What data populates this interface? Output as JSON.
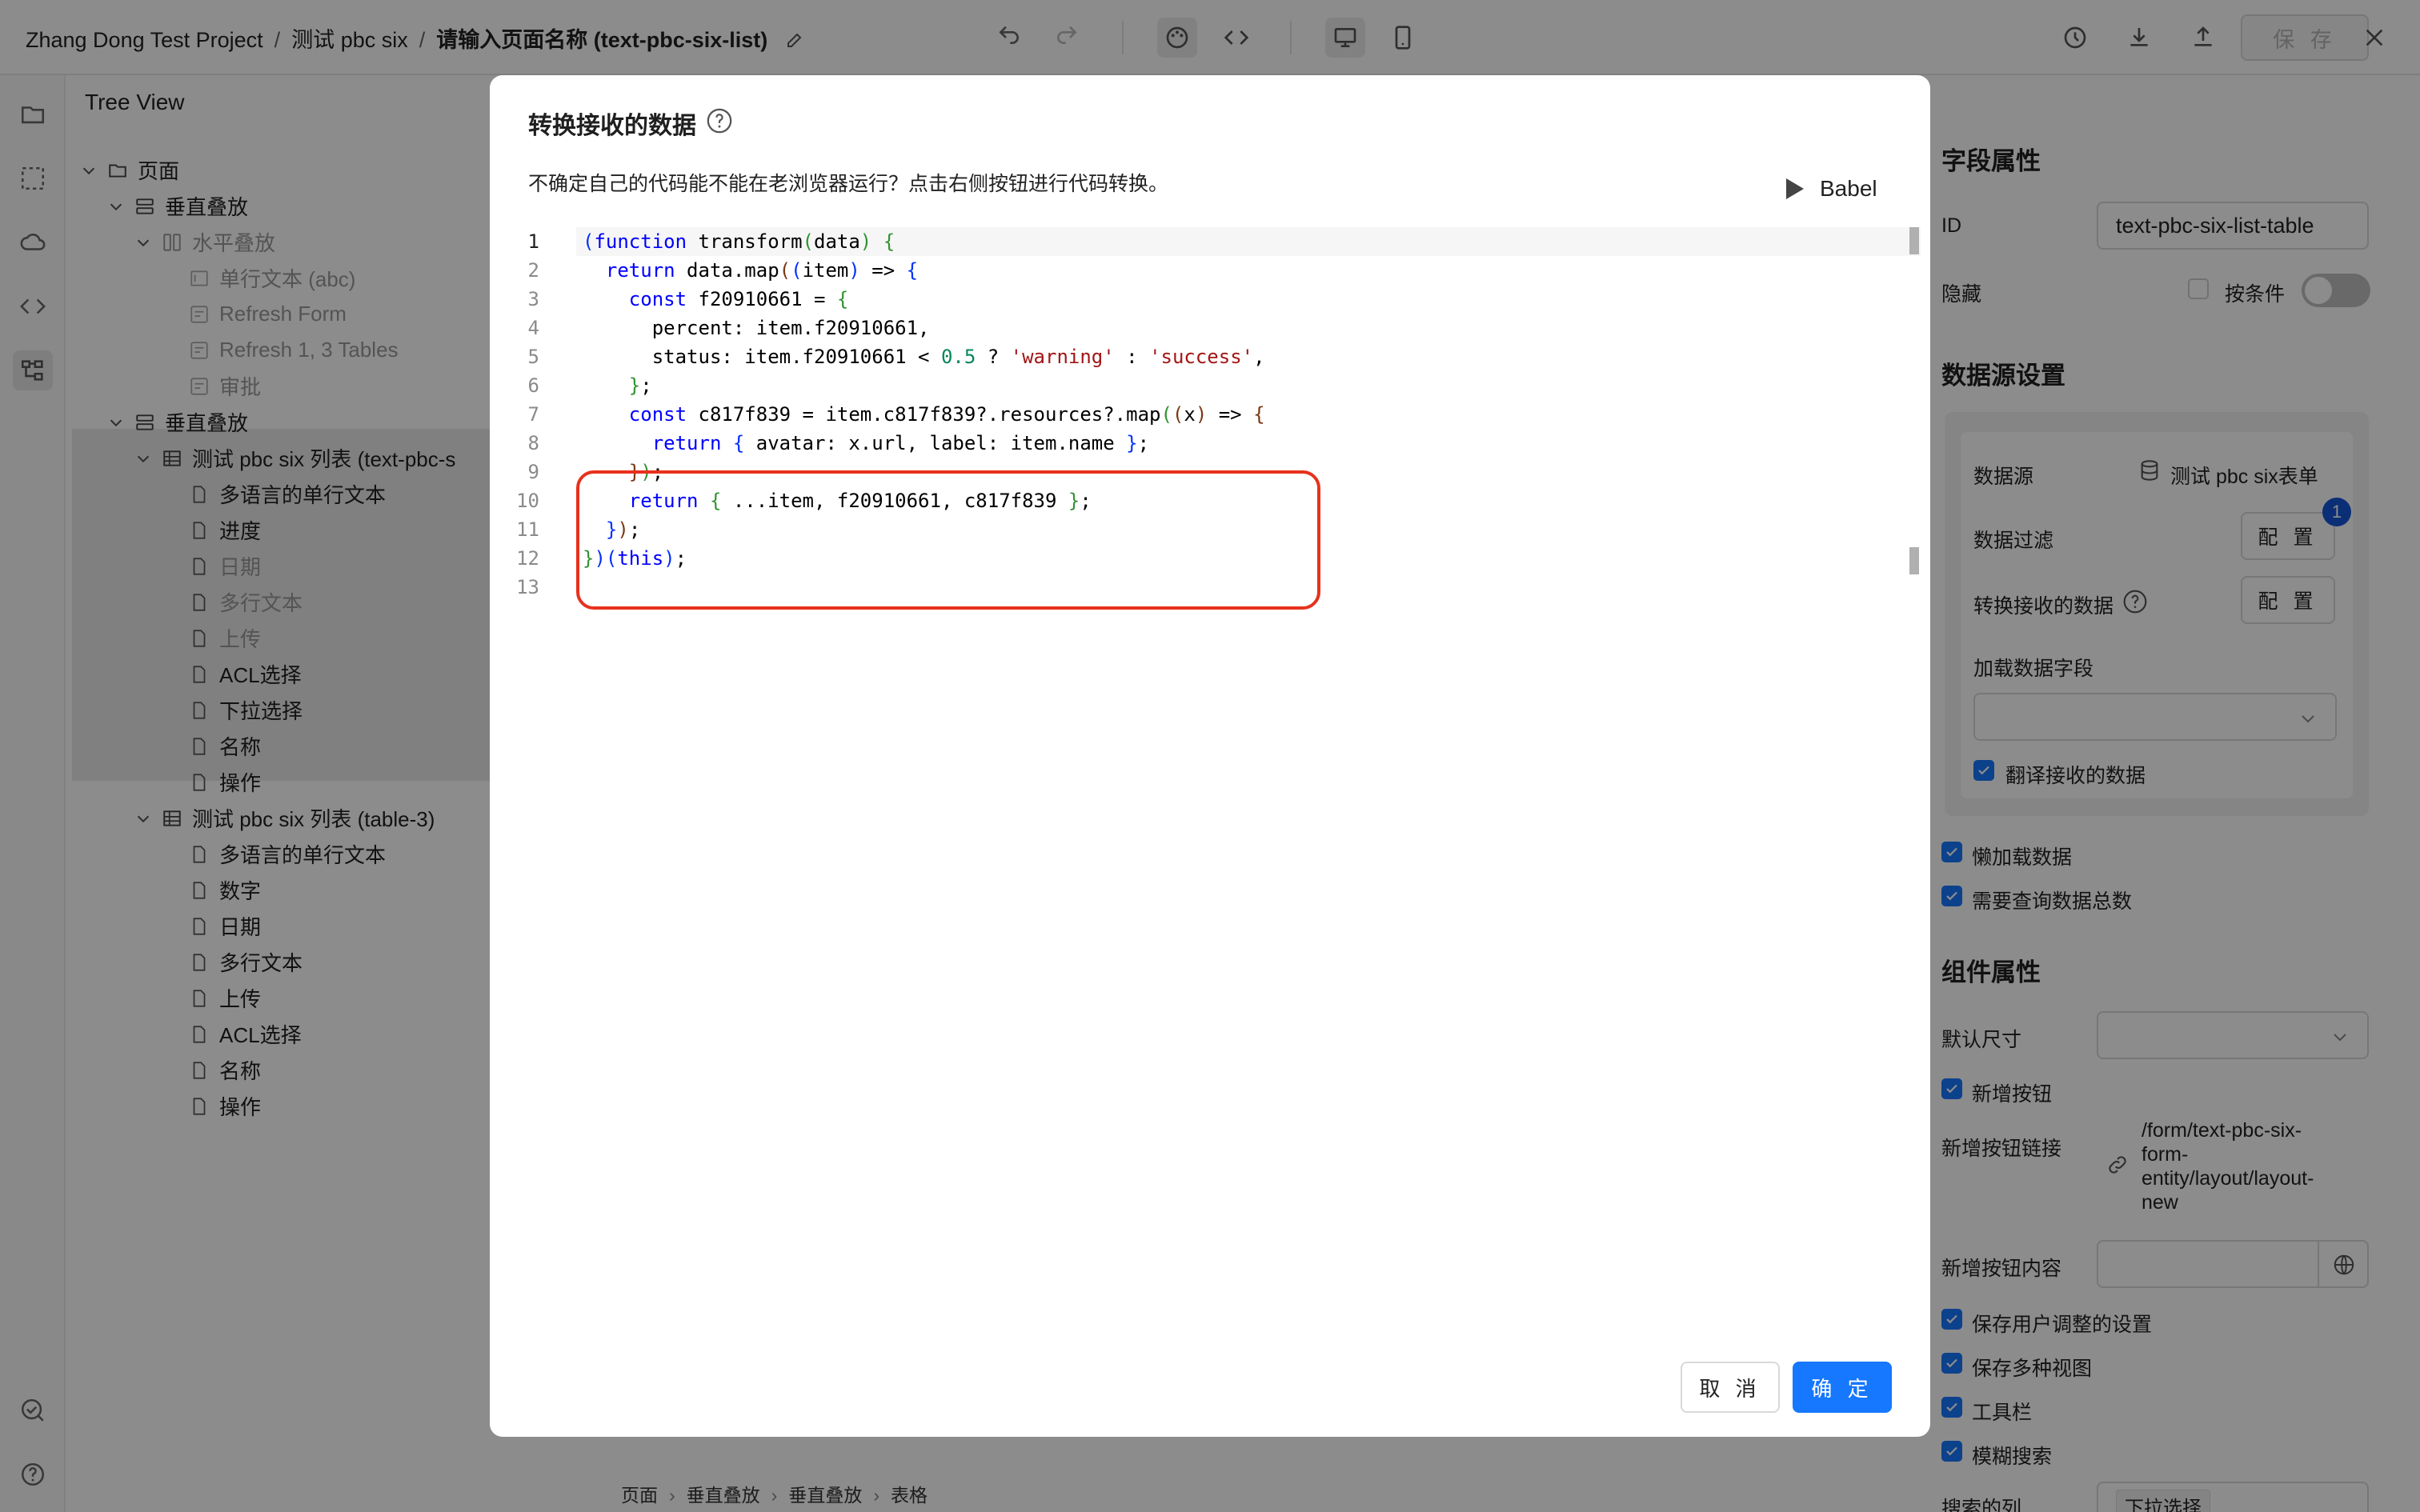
{
  "topbar": {
    "project": "Zhang Dong Test Project",
    "page_group": "测试 pbc six",
    "page_name": "请输入页面名称 (text-pbc-six-list)",
    "save_label": "保 存"
  },
  "tree": {
    "title": "Tree View",
    "nodes": [
      {
        "label": "页面"
      },
      {
        "label": "垂直叠放"
      },
      {
        "label": "水平叠放"
      },
      {
        "label": "单行文本 (abc)"
      },
      {
        "label": "Refresh Form"
      },
      {
        "label": "Refresh 1, 3 Tables"
      },
      {
        "label": "审批"
      },
      {
        "label": "垂直叠放"
      },
      {
        "label": "测试 pbc six 列表 (text-pbc-s"
      },
      {
        "label": "多语言的单行文本"
      },
      {
        "label": "进度"
      },
      {
        "label": "日期"
      },
      {
        "label": "多行文本"
      },
      {
        "label": "上传"
      },
      {
        "label": "ACL选择"
      },
      {
        "label": "下拉选择"
      },
      {
        "label": "名称"
      },
      {
        "label": "操作"
      },
      {
        "label": "测试 pbc six 列表 (table-3)"
      },
      {
        "label": "多语言的单行文本"
      },
      {
        "label": "数字"
      },
      {
        "label": "日期"
      },
      {
        "label": "多行文本"
      },
      {
        "label": "上传"
      },
      {
        "label": "ACL选择"
      },
      {
        "label": "名称"
      },
      {
        "label": "操作"
      }
    ]
  },
  "modal": {
    "title": "转换接收的数据",
    "description": "不确定自己的代码能不能在老浏览器运行？点击右侧按钮进行代码转换。",
    "babel_label": "Babel",
    "cancel_label": "取 消",
    "ok_label": "确 定",
    "code": {
      "line_numbers": [
        "1",
        "2",
        "3",
        "4",
        "5",
        "6",
        "7",
        "8",
        "9",
        "10",
        "11",
        "12",
        "13"
      ],
      "l1": {
        "kw": "function",
        "name": " transform",
        "arg": "data"
      },
      "l2": {
        "kw": "return",
        "call": " data.map",
        "arg": "item",
        "arrow": " => "
      },
      "l3": {
        "kw": "const",
        "name": " f20910661 = "
      },
      "l4": {
        "text": "percent: item.f20910661,"
      },
      "l5": {
        "pre": "status: item.f20910661 < ",
        "num": "0.5",
        "mid": " ? ",
        "s1": "'warning'",
        "colon": " : ",
        "s2": "'success'",
        "end": ","
      },
      "l7": {
        "kw": "const",
        "name": " c817f839 = item.c817f839?.resources?.map",
        "arg": "x",
        "arrow": " => "
      },
      "l8": {
        "kw": "return",
        "body": " avatar: x.url, label: item.name "
      },
      "l10": {
        "kw": "return",
        "body": " ...item, f20910661, c817f839 "
      },
      "l12": {
        "kw": "this"
      }
    }
  },
  "right": {
    "field_props_title": "字段属性",
    "id_label": "ID",
    "id_value": "text-pbc-six-list-table",
    "hidden_label": "隐藏",
    "by_condition_label": "按条件",
    "ds_title": "数据源设置",
    "ds_label": "数据源",
    "ds_value": "测试 pbc six表单",
    "filter_label": "数据过滤",
    "filter_badge": "1",
    "config_label": "配 置",
    "transform_label": "转换接收的数据",
    "load_fields_label": "加载数据字段",
    "translate_label": "翻译接收的数据",
    "lazy_label": "懒加载数据",
    "total_label": "需要查询数据总数",
    "comp_title": "组件属性",
    "default_size_label": "默认尺寸",
    "add_btn_label": "新增按钮",
    "add_btn_link_label": "新增按钮链接",
    "add_btn_link_value": [
      "/form/text-pbc-six-",
      "form-",
      "entity/layout/layout-",
      "new"
    ],
    "add_btn_content_label": "新增按钮内容",
    "save_user_settings_label": "保存用户调整的设置",
    "save_views_label": "保存多种视图",
    "toolbar_label": "工具栏",
    "fuzzy_label": "模糊搜索",
    "search_cols_label": "搜索的列",
    "search_cols_tag": "下拉选择"
  },
  "bottom_crumb": [
    "页面",
    "垂直叠放",
    "垂直叠放",
    "表格"
  ]
}
